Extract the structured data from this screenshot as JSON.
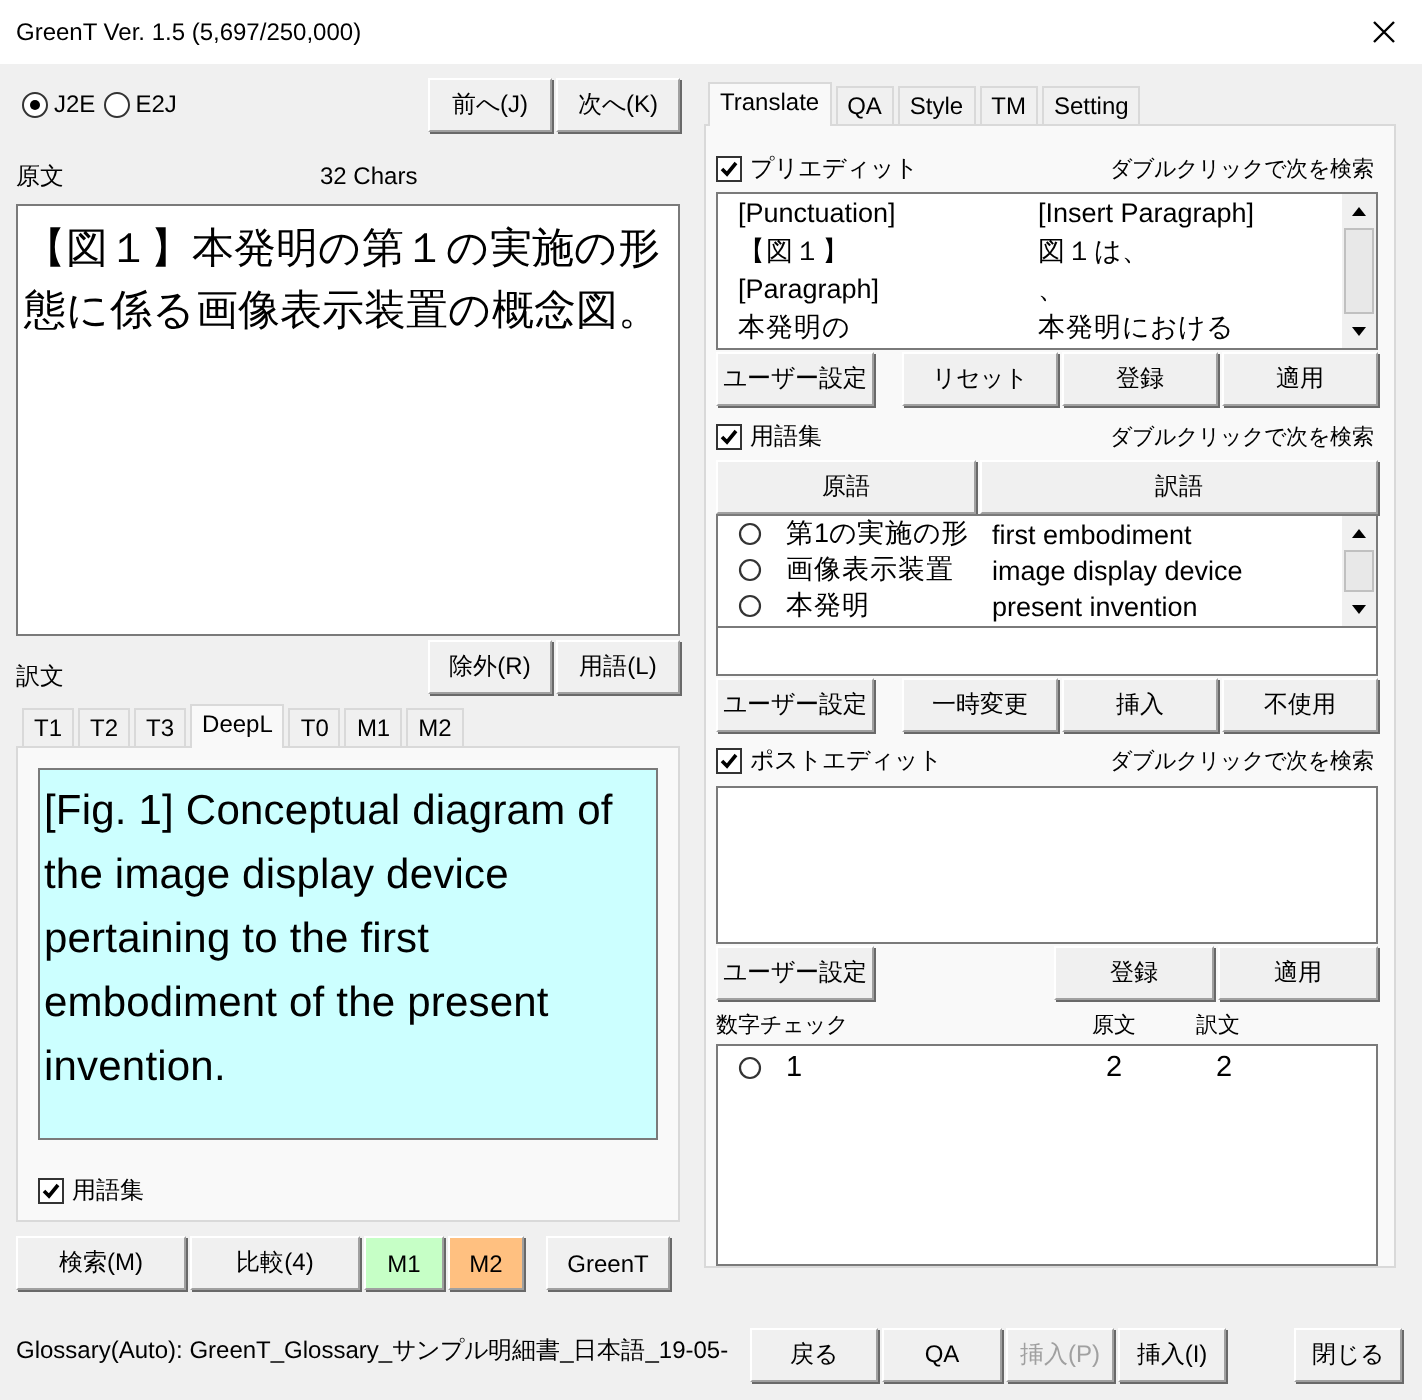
{
  "window": {
    "title": "GreenT Ver. 1.5 (5,697/250,000)"
  },
  "direction": [
    {
      "label": "J2E",
      "selected": true
    },
    {
      "label": "E2J",
      "selected": false
    }
  ],
  "nav_buttons": [
    "前へ(J)",
    "次へ(K)"
  ],
  "source": {
    "label": "原文",
    "count": "32 Chars",
    "text": "【図１】本発明の第１の実施の形態に係る画像表示装置の概念図。"
  },
  "target": {
    "label": "訳文",
    "buttons": [
      "除外(R)",
      "用語(L)"
    ],
    "tabs": [
      {
        "label": "T1",
        "selected": false
      },
      {
        "label": "T2",
        "selected": false
      },
      {
        "label": "T3",
        "selected": false
      },
      {
        "label": "DeepL",
        "selected": true
      },
      {
        "label": "T0",
        "selected": false
      },
      {
        "label": "M1",
        "selected": false
      },
      {
        "label": "M2",
        "selected": false
      }
    ],
    "text": "[Fig. 1] Conceptual diagram of the image display device pertaining to the first embodiment of the present invention.",
    "glossary_option": {
      "label": "用語集",
      "checked": true
    }
  },
  "bottom_buttons": [
    {
      "label": "検索(M)"
    },
    {
      "label": "比較(4)"
    },
    {
      "label": "M1",
      "color": "#c6ffc6"
    },
    {
      "label": "M2",
      "color": "#ffc080"
    },
    {
      "label": "GreenT"
    }
  ],
  "right_tabs": [
    {
      "label": "Translate",
      "selected": true
    },
    {
      "label": "QA",
      "selected": false
    },
    {
      "label": "Style",
      "selected": false
    },
    {
      "label": "TM",
      "selected": false
    },
    {
      "label": "Setting",
      "selected": false
    }
  ],
  "pre_edit": {
    "label": "プリエディット",
    "checked": true,
    "hint": "ダブルクリックで次を検索",
    "rows": [
      {
        "source": "[Punctuation]",
        "target": "[Insert Paragraph]"
      },
      {
        "source": "【図１】",
        "target": "図１は、"
      },
      {
        "source": "[Paragraph]",
        "target": "、"
      },
      {
        "source": "本発明の",
        "target": "本発明における"
      }
    ],
    "buttons": [
      "ユーザー設定",
      "リセット",
      "登録",
      "適用"
    ]
  },
  "glossary": {
    "label": "用語集",
    "checked": true,
    "hint": "ダブルクリックで次を検索",
    "columns": [
      "原語",
      "訳語"
    ],
    "rows": [
      {
        "source": "第1の実施の形",
        "target": "first embodiment"
      },
      {
        "source": "画像表示装置",
        "target": "image display device"
      },
      {
        "source": "本発明",
        "target": "present invention"
      }
    ],
    "buttons": [
      "ユーザー設定",
      "一時変更",
      "挿入",
      "不使用"
    ]
  },
  "post_edit": {
    "label": "ポストエディット",
    "checked": true,
    "hint": "ダブルクリックで次を検索",
    "buttons": [
      "ユーザー設定",
      "登録",
      "適用"
    ]
  },
  "number_check": {
    "label": "数字チェック",
    "columns": [
      "原文",
      "訳文"
    ],
    "rows": [
      {
        "number": "1",
        "source": "2",
        "target": "2"
      }
    ]
  },
  "status_bar": {
    "text": "Glossary(Auto): GreenT_Glossary_サンプル明細書_日本語_19-05-"
  },
  "footer_buttons": [
    {
      "label": "戻る",
      "disabled": false
    },
    {
      "label": "QA",
      "disabled": false
    },
    {
      "label": "挿入(P)",
      "disabled": true
    },
    {
      "label": "挿入(I)",
      "disabled": false
    },
    {
      "label": "閉じる",
      "disabled": false
    }
  ]
}
